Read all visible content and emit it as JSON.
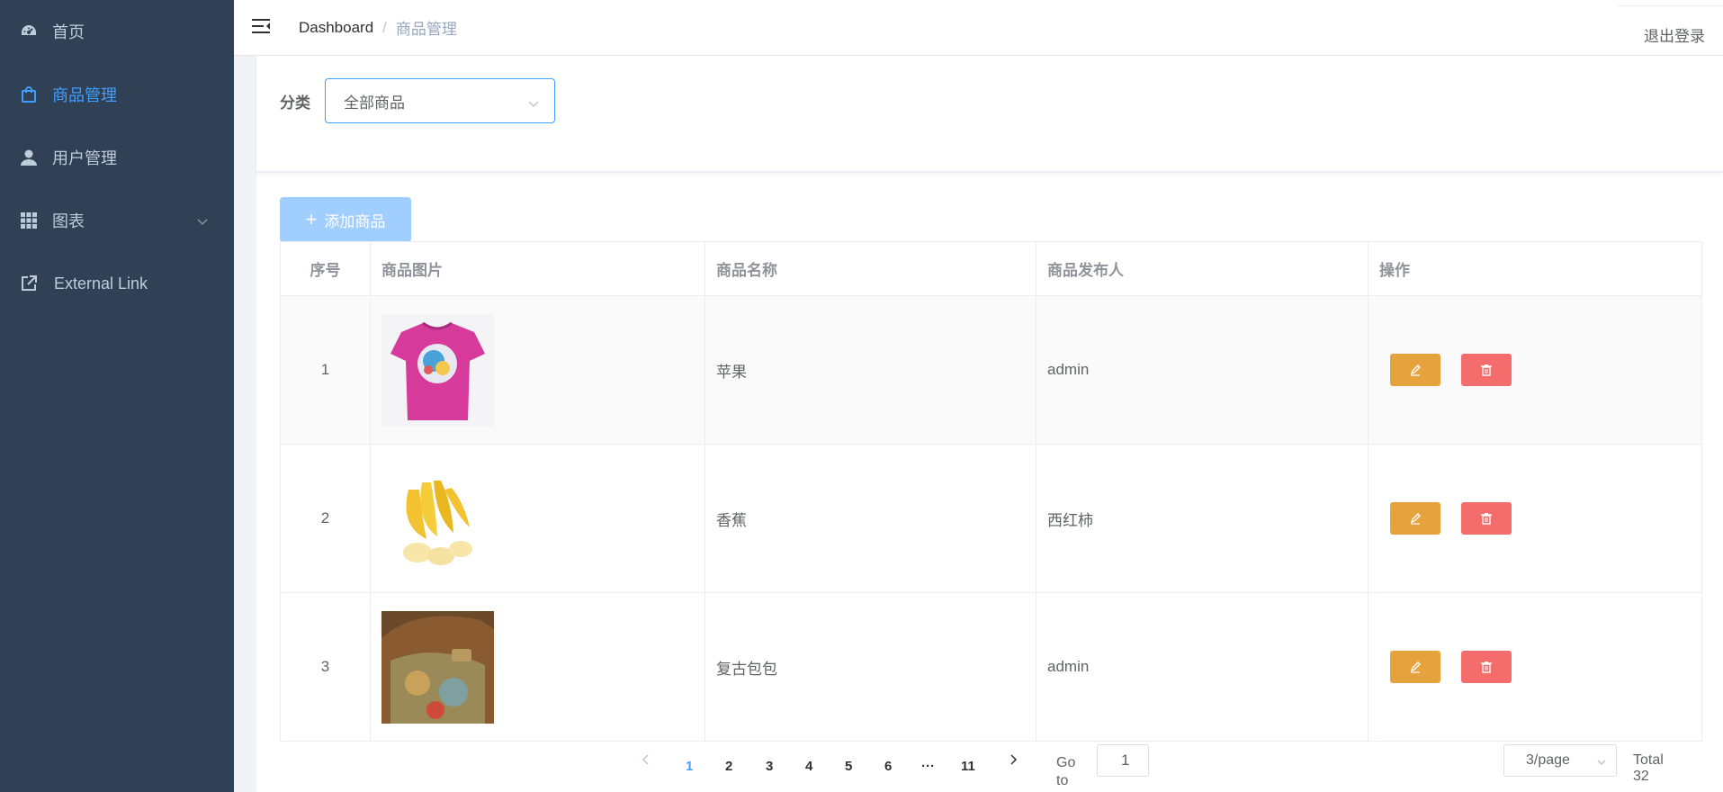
{
  "sidebar": {
    "items": [
      {
        "label": "首页",
        "icon": "dashboard-icon",
        "active": false
      },
      {
        "label": "商品管理",
        "icon": "shopping-bag-icon",
        "active": true
      },
      {
        "label": "用户管理",
        "icon": "user-icon",
        "active": false
      },
      {
        "label": "图表",
        "icon": "grid-icon",
        "active": false,
        "has_submenu": true
      },
      {
        "label": "External Link",
        "icon": "external-link-icon",
        "active": false
      }
    ]
  },
  "header": {
    "breadcrumb": [
      "Dashboard",
      "商品管理"
    ],
    "logout_label": "退出登录"
  },
  "filter": {
    "label": "分类",
    "selected": "全部商品"
  },
  "toolbar": {
    "add_label": "添加商品"
  },
  "table": {
    "columns": [
      "序号",
      "商品图片",
      "商品名称",
      "商品发布人",
      "操作"
    ],
    "rows": [
      {
        "index": "1",
        "image": "pink-tshirt",
        "name": "苹果",
        "publisher": "admin"
      },
      {
        "index": "2",
        "image": "bananas",
        "name": "香蕉",
        "publisher": "西红柿"
      },
      {
        "index": "3",
        "image": "vintage-bag",
        "name": "复古包包",
        "publisher": "admin"
      }
    ]
  },
  "pagination": {
    "pages": [
      "1",
      "2",
      "3",
      "4",
      "5",
      "6",
      "11"
    ],
    "ellipsis": "···",
    "current_page": "1",
    "goto_label": "Go to",
    "goto_value": "1",
    "page_size": "3/page",
    "total": "Total 32"
  },
  "colors": {
    "sidebar_bg": "#304156",
    "sidebar_text": "#bfcbd9",
    "accent": "#409eff",
    "edit": "#e6a23c",
    "delete": "#f56c6c",
    "add_button": "#a0cfff"
  }
}
